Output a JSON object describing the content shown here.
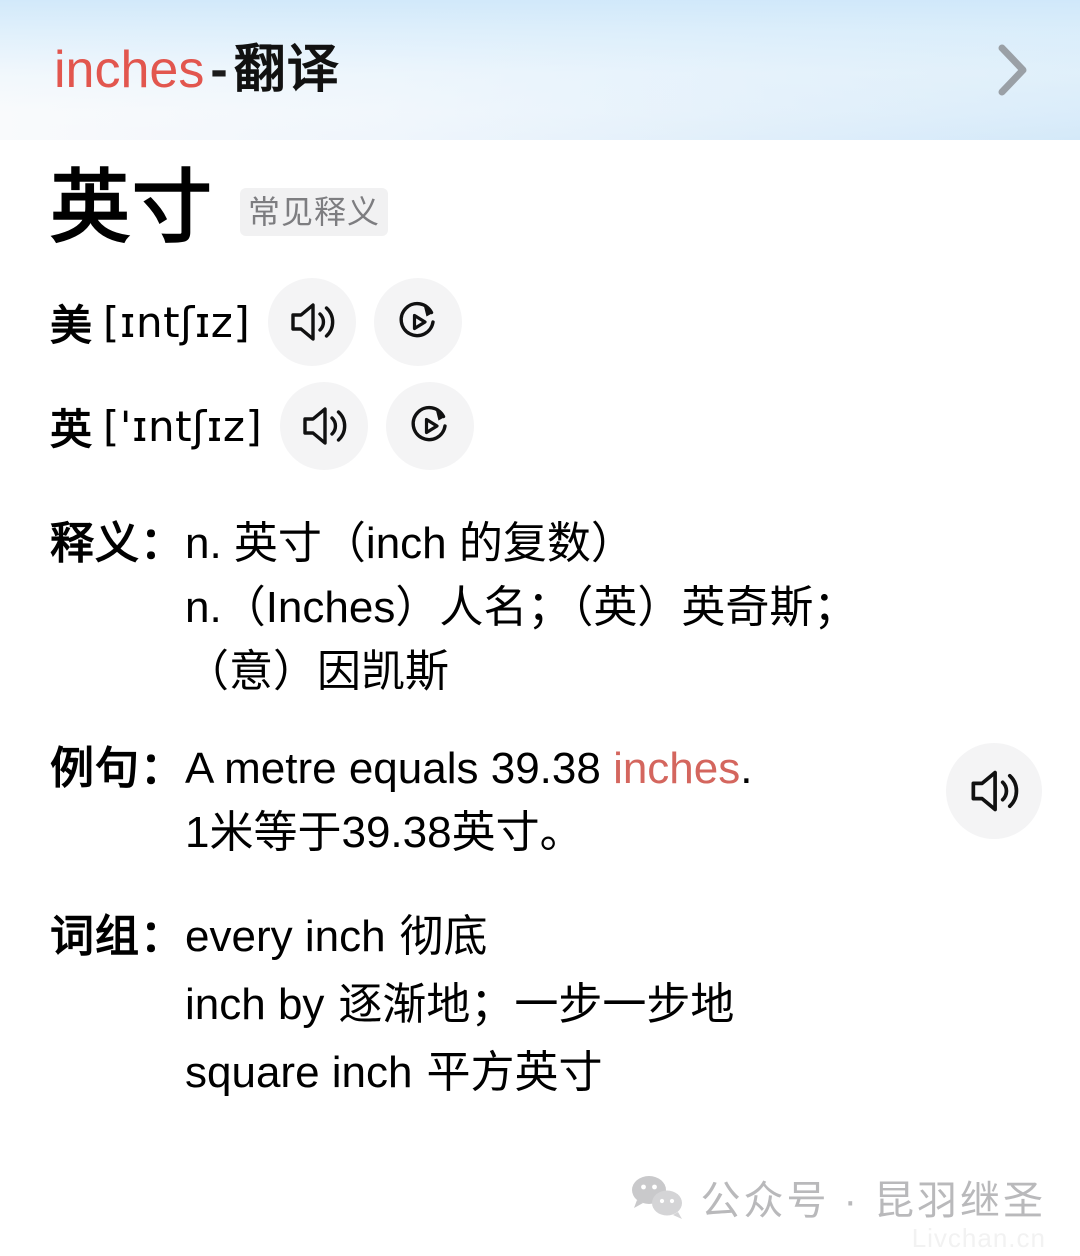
{
  "header": {
    "word": "inches",
    "separator": "-",
    "section": "翻译",
    "chevron_icon": "chevron-right-icon",
    "word_color": "#e2564e"
  },
  "entry": {
    "headword": "英寸",
    "badge": "常见释义",
    "pronunciations": [
      {
        "region": "美",
        "ipa": "[ɪntʃɪz]",
        "speaker_icon": "speaker-icon",
        "replay_icon": "replay-play-icon"
      },
      {
        "region": "英",
        "ipa": "['ɪntʃɪz]",
        "speaker_icon": "speaker-icon",
        "replay_icon": "replay-play-icon"
      }
    ],
    "meanings": {
      "label": "释义：",
      "lines": [
        "n. 英寸（inch 的复数）",
        "n.（Inches）人名；（英）英奇斯；",
        "（意）因凯斯"
      ]
    },
    "example": {
      "label": "例句：",
      "en_prefix": "A metre equals 39.38 ",
      "en_highlight": "inches",
      "en_suffix": ".",
      "cn": "1米等于39.38英寸。",
      "speaker_icon": "speaker-icon",
      "highlight_color": "#d4665e"
    },
    "phrases": {
      "label": "词组：",
      "items": [
        {
          "en": "every inch",
          "cn": "彻底"
        },
        {
          "en": "inch by",
          "cn": "逐渐地；一步一步地"
        },
        {
          "en": "square inch",
          "cn": "平方英寸"
        }
      ]
    }
  },
  "watermark": {
    "logo_icon": "wechat-icon",
    "text": "公众号 · 昆羽继圣",
    "sub": "Livchan.cn"
  }
}
